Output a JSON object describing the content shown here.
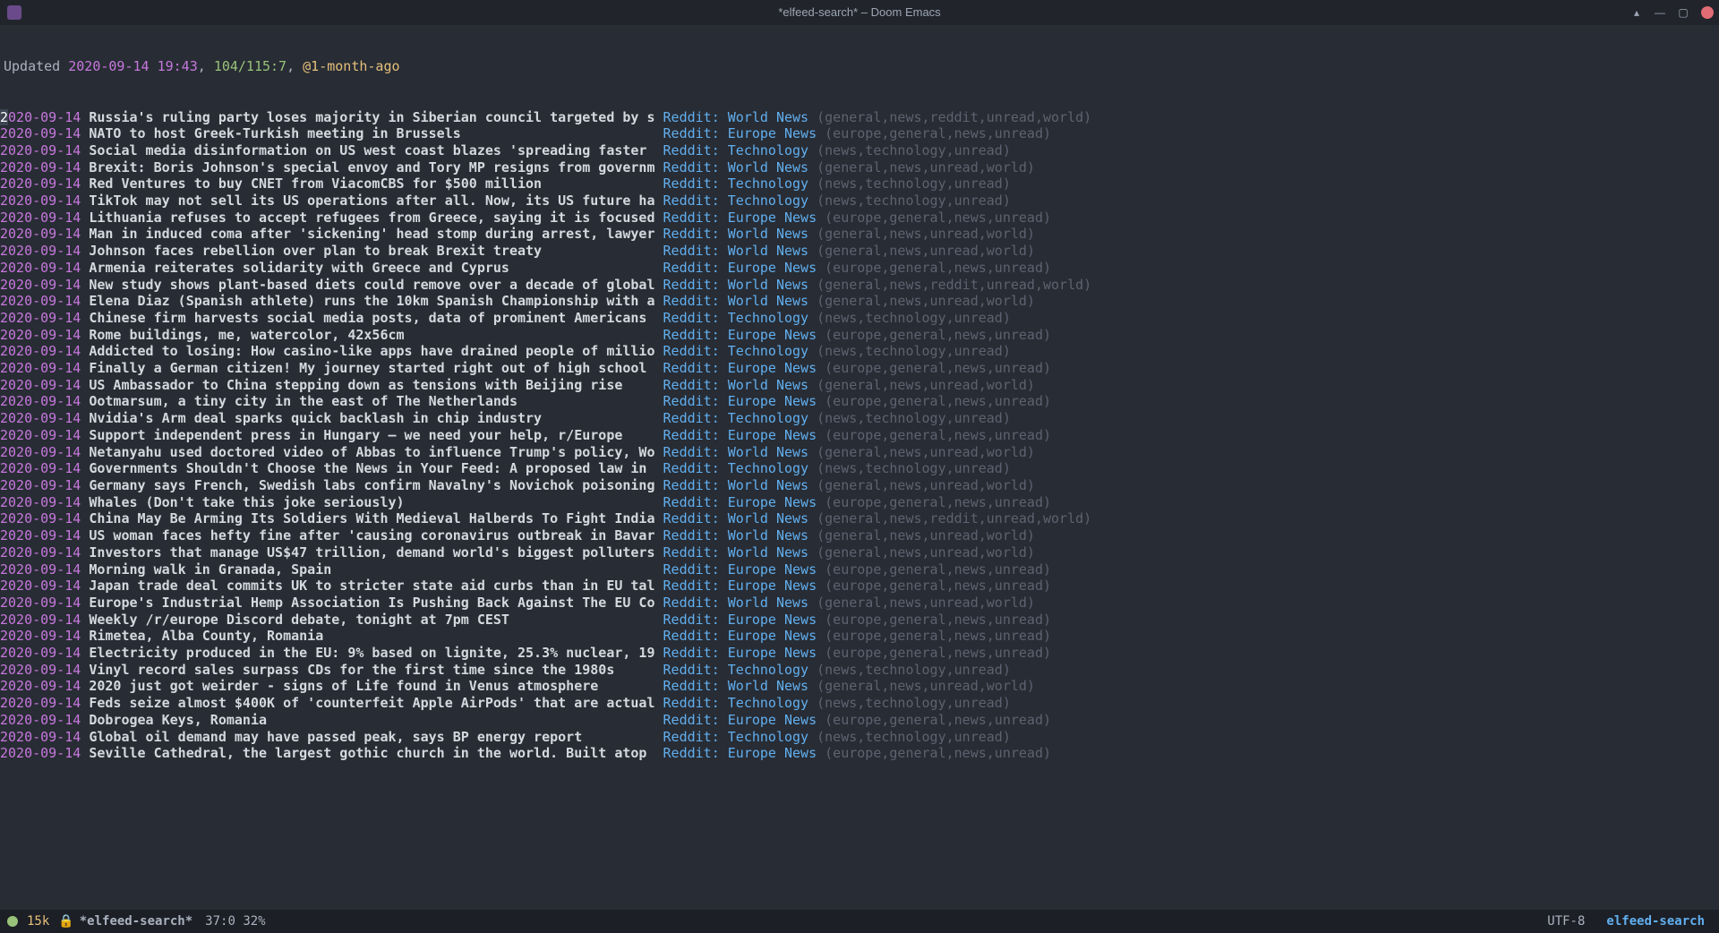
{
  "window": {
    "title": "*elfeed-search* – Doom Emacs"
  },
  "status": {
    "label": "Updated ",
    "datetime": "2020-09-14 19:43",
    "sep1": ", ",
    "count": "104/115:7",
    "sep2": ", ",
    "filter": "@1-month-ago"
  },
  "cols": {
    "title_width": 70
  },
  "feeds": {
    "world": "Reddit: World News",
    "europe": "Reddit: Europe News",
    "tech": "Reddit: Technology"
  },
  "tagsets": {
    "world": "(general,news,unread,world)",
    "world_reddit": "(general,news,reddit,unread,world)",
    "europe": "(europe,general,news,unread)",
    "tech": "(news,technology,unread)"
  },
  "entries": [
    {
      "date": "2020-09-14",
      "title": "Russia's ruling party loses majority in Siberian council targeted by s",
      "feed": "world",
      "tags": "world_reddit",
      "cursor": true
    },
    {
      "date": "2020-09-14",
      "title": "NATO to host Greek-Turkish meeting in Brussels",
      "feed": "europe",
      "tags": "europe"
    },
    {
      "date": "2020-09-14",
      "title": "Social media disinformation on US west coast blazes 'spreading faster",
      "feed": "tech",
      "tags": "tech"
    },
    {
      "date": "2020-09-14",
      "title": "Brexit: Boris Johnson's special envoy and Tory MP resigns from governm",
      "feed": "world",
      "tags": "world"
    },
    {
      "date": "2020-09-14",
      "title": "Red Ventures to buy CNET from ViacomCBS for $500 million",
      "feed": "tech",
      "tags": "tech"
    },
    {
      "date": "2020-09-14",
      "title": "TikTok may not sell its US operations after all. Now, its US future ha",
      "feed": "tech",
      "tags": "tech"
    },
    {
      "date": "2020-09-14",
      "title": "Lithuania refuses to accept refugees from Greece, saying it is focused",
      "feed": "europe",
      "tags": "europe"
    },
    {
      "date": "2020-09-14",
      "title": "Man in induced coma after 'sickening' head stomp during arrest, lawyer",
      "feed": "world",
      "tags": "world"
    },
    {
      "date": "2020-09-14",
      "title": "Johnson faces rebellion over plan to break Brexit treaty",
      "feed": "world",
      "tags": "world"
    },
    {
      "date": "2020-09-14",
      "title": "Armenia reiterates solidarity with Greece and Cyprus",
      "feed": "europe",
      "tags": "europe"
    },
    {
      "date": "2020-09-14",
      "title": "New study shows plant-based diets could remove over a decade of global",
      "feed": "world",
      "tags": "world_reddit"
    },
    {
      "date": "2020-09-14",
      "title": "Elena Diaz (Spanish athlete) runs the 10km Spanish Championship with a",
      "feed": "world",
      "tags": "world"
    },
    {
      "date": "2020-09-14",
      "title": "Chinese firm harvests social media posts, data of prominent Americans",
      "feed": "tech",
      "tags": "tech"
    },
    {
      "date": "2020-09-14",
      "title": "Rome buildings, me, watercolor, 42x56cm",
      "feed": "europe",
      "tags": "europe"
    },
    {
      "date": "2020-09-14",
      "title": "Addicted to losing: How casino-like apps have drained people of millio",
      "feed": "tech",
      "tags": "tech"
    },
    {
      "date": "2020-09-14",
      "title": "Finally a German citizen! My journey started right out of high school",
      "feed": "europe",
      "tags": "europe"
    },
    {
      "date": "2020-09-14",
      "title": "US Ambassador to China stepping down as tensions with Beijing rise",
      "feed": "world",
      "tags": "world"
    },
    {
      "date": "2020-09-14",
      "title": "Ootmarsum, a tiny city in the east of The Netherlands",
      "feed": "europe",
      "tags": "europe"
    },
    {
      "date": "2020-09-14",
      "title": "Nvidia's Arm deal sparks quick backlash in chip industry",
      "feed": "tech",
      "tags": "tech"
    },
    {
      "date": "2020-09-14",
      "title": "Support independent press in Hungary – we need your help, r/Europe",
      "feed": "europe",
      "tags": "europe"
    },
    {
      "date": "2020-09-14",
      "title": "Netanyahu used doctored video of Abbas to influence Trump's policy, Wo",
      "feed": "world",
      "tags": "world"
    },
    {
      "date": "2020-09-14",
      "title": "Governments Shouldn't Choose the News in Your Feed: A proposed law in",
      "feed": "tech",
      "tags": "tech"
    },
    {
      "date": "2020-09-14",
      "title": "Germany says French, Swedish labs confirm Navalny's Novichok poisoning",
      "feed": "world",
      "tags": "world"
    },
    {
      "date": "2020-09-14",
      "title": "Whales (Don't take this joke seriously)",
      "feed": "europe",
      "tags": "europe"
    },
    {
      "date": "2020-09-14",
      "title": "China May Be Arming Its Soldiers With Medieval Halberds To Fight India",
      "feed": "world",
      "tags": "world_reddit"
    },
    {
      "date": "2020-09-14",
      "title": "US woman faces hefty fine after 'causing coronavirus outbreak in Bavar",
      "feed": "world",
      "tags": "world"
    },
    {
      "date": "2020-09-14",
      "title": "Investors that manage US$47 trillion, demand world's biggest polluters",
      "feed": "world",
      "tags": "world"
    },
    {
      "date": "2020-09-14",
      "title": "Morning walk in Granada, Spain",
      "feed": "europe",
      "tags": "europe"
    },
    {
      "date": "2020-09-14",
      "title": "Japan trade deal commits UK to stricter state aid curbs than in EU tal",
      "feed": "europe",
      "tags": "europe"
    },
    {
      "date": "2020-09-14",
      "title": "Europe's Industrial Hemp Association Is Pushing Back Against The EU Co",
      "feed": "world",
      "tags": "world"
    },
    {
      "date": "2020-09-14",
      "title": "Weekly /r/europe Discord debate, tonight at 7pm CEST",
      "feed": "europe",
      "tags": "europe"
    },
    {
      "date": "2020-09-14",
      "title": "Rimetea, Alba County, Romania",
      "feed": "europe",
      "tags": "europe"
    },
    {
      "date": "2020-09-14",
      "title": "Electricity produced in the EU: 9% based on lignite, 25.3% nuclear, 19",
      "feed": "europe",
      "tags": "europe"
    },
    {
      "date": "2020-09-14",
      "title": "Vinyl record sales surpass CDs for the first time since the 1980s",
      "feed": "tech",
      "tags": "tech"
    },
    {
      "date": "2020-09-14",
      "title": "2020 just got weirder - signs of Life found in Venus atmosphere",
      "feed": "world",
      "tags": "world"
    },
    {
      "date": "2020-09-14",
      "title": "Feds seize almost $400K of 'counterfeit Apple AirPods' that are actual",
      "feed": "tech",
      "tags": "tech"
    },
    {
      "date": "2020-09-14",
      "title": "Dobrogea Keys, Romania",
      "feed": "europe",
      "tags": "europe"
    },
    {
      "date": "2020-09-14",
      "title": "Global oil demand may have passed peak, says BP energy report",
      "feed": "tech",
      "tags": "tech"
    },
    {
      "date": "2020-09-14",
      "title": "Seville Cathedral, the largest gothic church in the world. Built atop",
      "feed": "europe",
      "tags": "europe"
    }
  ],
  "modeline": {
    "warn": "15k",
    "lock_glyph": "🔒",
    "buffer": "*elfeed-search*",
    "pos": "37:0 32%",
    "encoding": "UTF-8",
    "major_mode": "elfeed-search"
  }
}
